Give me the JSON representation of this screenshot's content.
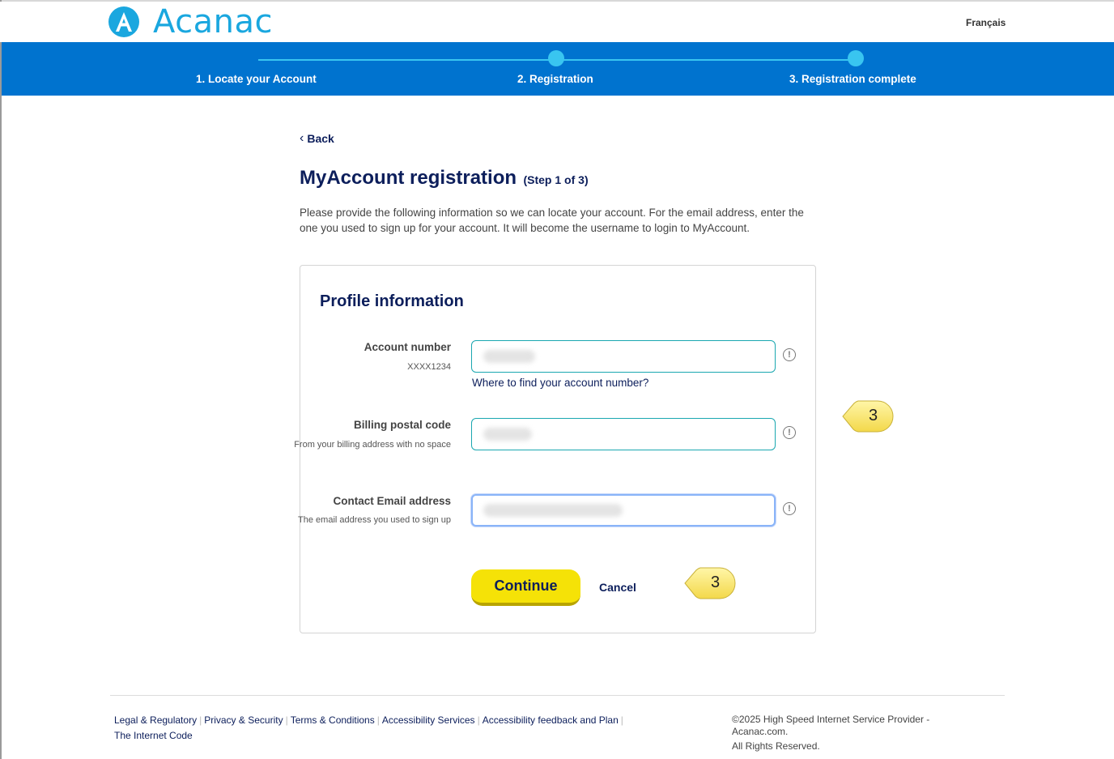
{
  "header": {
    "brand": "Acanac",
    "language_link": "Français"
  },
  "stepper": {
    "steps": [
      {
        "label": "1. Locate your Account"
      },
      {
        "label": "2. Registration"
      },
      {
        "label": "3. Registration complete"
      }
    ]
  },
  "nav": {
    "back_label": "Back"
  },
  "page": {
    "title": "MyAccount registration",
    "step_indicator": "(Step 1 of 3)",
    "intro": "Please provide the following information so we can locate your account. For the email address, enter the one you used to sign up for your account. It will become the username to login to MyAccount."
  },
  "form": {
    "title": "Profile information",
    "fields": [
      {
        "label": "Account number",
        "hint": "XXXX1234"
      },
      {
        "label": "Billing postal code",
        "hint": "From your billing address with no space"
      },
      {
        "label": "Contact Email address",
        "hint": "The email address you used to sign up"
      }
    ],
    "help_link": "Where to find your account number?",
    "info_glyph": "!",
    "continue_label": "Continue",
    "cancel_label": "Cancel"
  },
  "annotations": {
    "callout_1": "3",
    "callout_2": "3"
  },
  "footer": {
    "links": [
      "Legal & Regulatory",
      "Privacy & Security",
      "Terms & Conditions",
      "Accessibility Services",
      "Accessibility feedback and Plan",
      "The Internet Code"
    ],
    "copyright": "©2025 High Speed Internet Service Provider - Acanac.com.",
    "rights": "All Rights Reserved."
  },
  "colors": {
    "brand_blue": "#1aa7df",
    "stepper_bg": "#0073cf",
    "navy": "#0c1e5b",
    "button_yellow": "#f5e207"
  }
}
